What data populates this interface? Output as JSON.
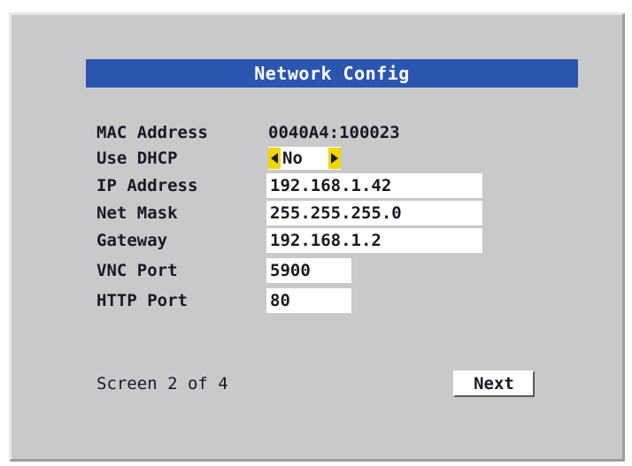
{
  "title": "Network Config",
  "fields": {
    "mac": {
      "label": "MAC Address",
      "value": "0040A4:100023"
    },
    "dhcp": {
      "label": "Use DHCP",
      "value": "No"
    },
    "ip": {
      "label": "IP Address",
      "value": "192.168.1.42"
    },
    "netmask": {
      "label": "Net Mask",
      "value": "255.255.255.0"
    },
    "gateway": {
      "label": "Gateway",
      "value": "192.168.1.2"
    },
    "vnc_port": {
      "label": "VNC Port",
      "value": "5900"
    },
    "http_port": {
      "label": "HTTP Port",
      "value": "80"
    }
  },
  "footer": {
    "screen_indicator": "Screen 2 of 4",
    "next_label": "Next"
  },
  "colors": {
    "panel": "#c9c9cc",
    "title_bar": "#2b56b0",
    "toggle_arrow": "#f1d600"
  },
  "icons": {
    "dhcp_prev": "arrow-left-icon",
    "dhcp_next": "arrow-right-icon"
  }
}
